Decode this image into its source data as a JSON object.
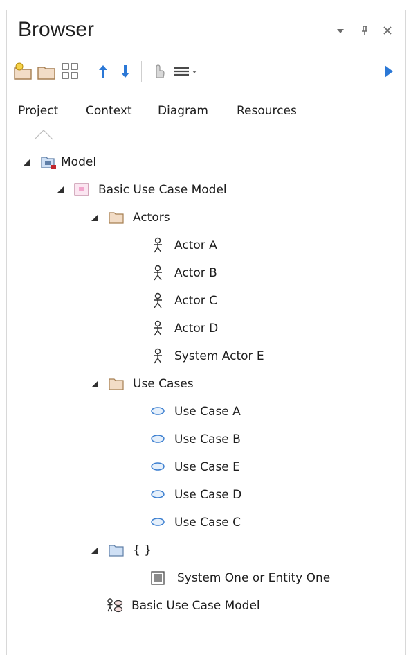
{
  "window": {
    "title": "Browser"
  },
  "tabs": [
    {
      "label": "Project"
    },
    {
      "label": "Context"
    },
    {
      "label": "Diagram"
    },
    {
      "label": "Resources"
    }
  ],
  "tree": {
    "model": "Model",
    "package": "Basic Use Case Model",
    "actors_folder": "Actors",
    "actors": [
      "Actor A",
      "Actor B",
      "Actor C",
      "Actor D",
      "System Actor E"
    ],
    "use_cases_folder": "Use Cases",
    "use_cases": [
      "Use Case A",
      "Use Case B",
      "Use Case E",
      "Use Case D",
      "Use Case C"
    ],
    "braces_folder": "{ }",
    "boundary": "System One or Entity One",
    "diagram": "Basic Use Case Model"
  },
  "colors": {
    "accent": "#2b78d6",
    "folder": "#f2dcc6",
    "folder_blue": "#cfe0f5",
    "usecase": "#3c7fd0"
  }
}
